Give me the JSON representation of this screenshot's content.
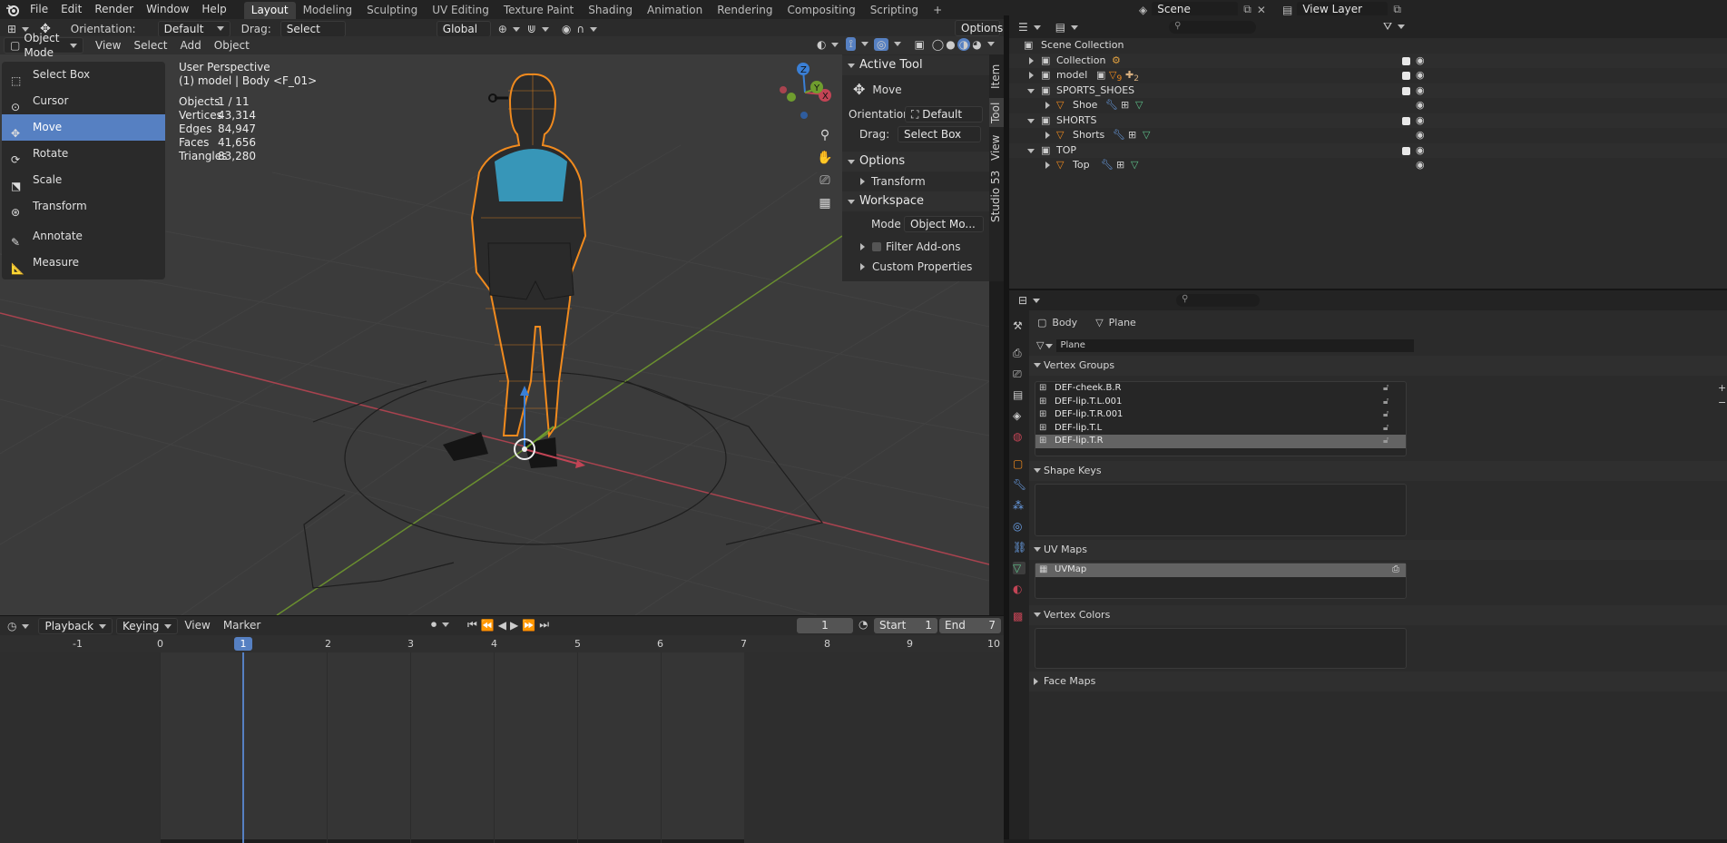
{
  "topbar": {
    "menus": [
      "File",
      "Edit",
      "Render",
      "Window",
      "Help"
    ],
    "workspaces": [
      "Layout",
      "Modeling",
      "Sculpting",
      "UV Editing",
      "Texture Paint",
      "Shading",
      "Animation",
      "Rendering",
      "Compositing",
      "Scripting"
    ],
    "active_workspace": "Layout",
    "add_tab": "+",
    "scene": "Scene",
    "view_layer": "View Layer"
  },
  "tool_header": {
    "orientation_label": "Orientation:",
    "orientation_value": "Default",
    "drag_label": "Drag:",
    "drag_value": "Select Box",
    "transform_orientation": "Global",
    "options": "Options"
  },
  "viewport_header": {
    "mode": "Object Mode",
    "menus": [
      "View",
      "Select",
      "Add",
      "Object"
    ]
  },
  "tools": [
    "Select Box",
    "Cursor",
    "Move",
    "Rotate",
    "Scale",
    "Transform",
    "Annotate",
    "Measure"
  ],
  "active_tool": "Move",
  "overlay": {
    "perspective": "User Perspective",
    "object_info": "(1) model | Body <F_01>",
    "stats": [
      {
        "label": "Objects",
        "value": "1 / 11"
      },
      {
        "label": "Vertices",
        "value": "43,314"
      },
      {
        "label": "Edges",
        "value": "84,947"
      },
      {
        "label": "Faces",
        "value": "41,656"
      },
      {
        "label": "Triangles",
        "value": "83,280"
      }
    ]
  },
  "gizmo": {
    "x": "X",
    "y": "Y",
    "z": "Z"
  },
  "npanel": {
    "active_tool_title": "Active Tool",
    "tool_name": "Move",
    "orientation_label": "Orientation",
    "orientation_value": "Default",
    "drag_label": "Drag:",
    "drag_value": "Select Box",
    "options_title": "Options",
    "transform": "Transform",
    "workspace_title": "Workspace",
    "mode_label": "Mode",
    "mode_value": "Object Mo...",
    "filter_addons": "Filter Add-ons",
    "custom_props": "Custom Properties",
    "tabs": [
      "Item",
      "Tool",
      "View",
      "Studio 53"
    ]
  },
  "outliner": {
    "rows": [
      {
        "name": "Scene Collection",
        "indent": 0
      },
      {
        "name": "Collection",
        "indent": 1
      },
      {
        "name": "model",
        "indent": 1
      },
      {
        "name": "SPORTS_SHOES",
        "indent": 1
      },
      {
        "name": "Shoe",
        "indent": 2
      },
      {
        "name": "SHORTS",
        "indent": 1
      },
      {
        "name": "Shorts",
        "indent": 2
      },
      {
        "name": "TOP",
        "indent": 1
      },
      {
        "name": "Top",
        "indent": 2
      }
    ],
    "model_badges": [
      "9",
      "2"
    ]
  },
  "properties": {
    "object_name": "Body",
    "mesh_name": "Plane",
    "mesh_field": "Plane",
    "vertex_groups_title": "Vertex Groups",
    "vertex_groups": [
      "DEF-cheek.B.R",
      "DEF-lip.T.L.001",
      "DEF-lip.T.R.001",
      "DEF-lip.T.L",
      "DEF-lip.T.R"
    ],
    "selected_group": "DEF-lip.T.R",
    "shape_keys_title": "Shape Keys",
    "uv_maps_title": "UV Maps",
    "uv_map": "UVMap",
    "vertex_colors_title": "Vertex Colors",
    "face_maps_title": "Face Maps"
  },
  "timeline": {
    "menus": [
      "Playback",
      "Keying",
      "View",
      "Marker"
    ],
    "current_frame": "1",
    "start_label": "Start",
    "start_value": "1",
    "end_label": "End",
    "end_value": "7",
    "ruler": [
      "-1",
      "0",
      "1",
      "2",
      "3",
      "4",
      "5",
      "6",
      "7",
      "8",
      "9",
      "10"
    ]
  },
  "colors": {
    "accent": "#5680c2",
    "selection_orange": "#f08a1e",
    "axis_x": "#c24455",
    "axis_y": "#6f9d2e",
    "axis_z": "#3a7fd5"
  }
}
